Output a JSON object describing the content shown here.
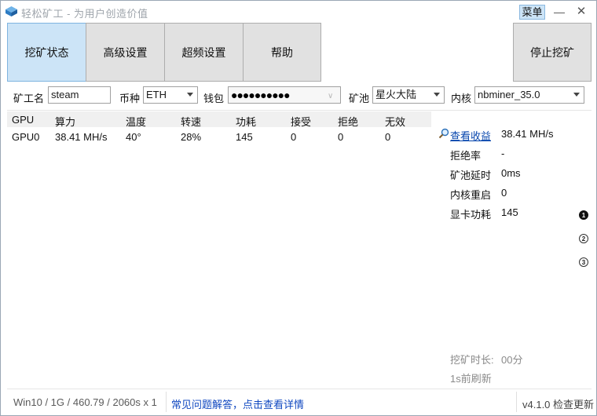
{
  "window": {
    "title": "轻松矿工 - 为用户创造价值",
    "menu_label": "菜单"
  },
  "tabs": [
    {
      "label": "挖矿状态",
      "active": true
    },
    {
      "label": "高级设置",
      "active": false
    },
    {
      "label": "超频设置",
      "active": false
    },
    {
      "label": "帮助",
      "active": false
    }
  ],
  "stop_button": "停止挖矿",
  "config": {
    "worker_label": "矿工名",
    "worker_value": "steam",
    "coin_label": "币种",
    "coin_value": "ETH",
    "wallet_label": "钱包",
    "wallet_value": "●●●●●●●●●●",
    "pool_label": "矿池",
    "pool_value": "星火大陆",
    "kernel_label": "内核",
    "kernel_value": "nbminer_35.0"
  },
  "table": {
    "headers": [
      "GPU",
      "算力",
      "温度",
      "转速",
      "功耗",
      "接受",
      "拒绝",
      "无效"
    ],
    "rows": [
      [
        "GPU0",
        "38.41 MH/s",
        "40°",
        "28%",
        "145",
        "0",
        "0",
        "0"
      ]
    ]
  },
  "stats": {
    "income_link": "查看收益",
    "hashrate": "38.41 MH/s",
    "reject_rate_label": "拒绝率",
    "reject_rate_value": "-",
    "pool_latency_label": "矿池延时",
    "pool_latency_value": "0ms",
    "kernel_restart_label": "内核重启",
    "kernel_restart_value": "0",
    "gpu_power_label": "显卡功耗",
    "gpu_power_value": "145",
    "runtime_label": "挖矿时长:",
    "runtime_value": "00分",
    "refresh_text": "1s前刷新"
  },
  "pages": [
    "1",
    "2",
    "3"
  ],
  "footer": {
    "sysinfo": "Win10 / 1G / 460.79 / 2060s x 1",
    "faq": "常见问题解答，点击查看详情",
    "version": "v4.1.0 检查更新"
  }
}
